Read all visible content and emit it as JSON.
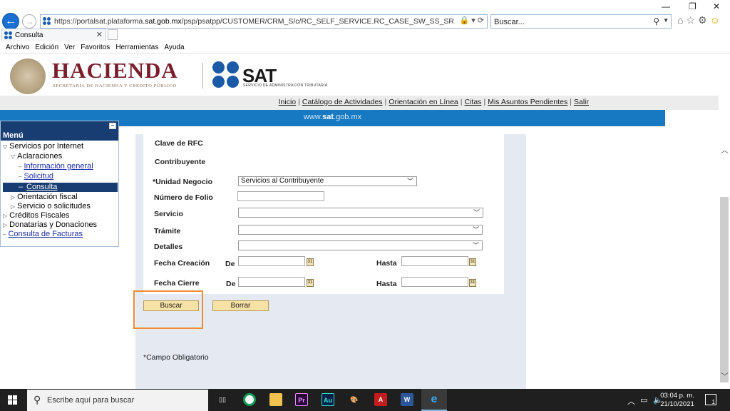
{
  "browser": {
    "url_prefix": "https://portalsat.plataforma.",
    "url_domain": "sat.gob.mx",
    "url_rest": "/psp/psatpp/CUSTOMER/CRM_S/c/RC_SELF_SERVICE.RC_CASE_SW_SS_SRCH.GBL?DISP_TMPL_ID=RC_SU",
    "search_placeholder": "Buscar...",
    "tab_title": "Consulta",
    "menu": [
      "Archivo",
      "Edición",
      "Ver",
      "Favoritos",
      "Herramientas",
      "Ayuda"
    ]
  },
  "header": {
    "hacienda_title": "HACIENDA",
    "hacienda_subtitle": "SECRETARÍA DE HACIENDA Y CRÉDITO PÚBLICO",
    "sat_title": "SAT",
    "sat_subtitle": "SERVICIO DE ADMINISTRACIÓN TRIBUTARIA"
  },
  "topnav": [
    "Inicio",
    "Catálogo de Actividades",
    "Orientación en Línea",
    "Citas",
    "Mis Asuntos Pendientes",
    "Salir"
  ],
  "bluebar": {
    "pre": "www.",
    "bold": "sat",
    "post": ".gob.mx"
  },
  "sidebar": {
    "title": "Menú",
    "items": [
      "Servicios por Internet",
      "Aclaraciones",
      "Información general",
      "Solicitud",
      "Consulta",
      "Orientación fiscal",
      "Servicio o solicitudes",
      "Créditos Fiscales",
      "Donatarias y Donaciones",
      "Consulta de Facturas"
    ]
  },
  "form": {
    "rfc_label": "Clave de RFC",
    "contribuyente_label": "Contribuyente",
    "unidad_label": "*Unidad Negocio",
    "unidad_value": "Servicios al Contribuyente",
    "folio_label": "Número de Folio",
    "servicio_label": "Servicio",
    "tramite_label": "Trámite",
    "detalles_label": "Detalles",
    "fecha_creacion_label": "Fecha Creación",
    "fecha_cierre_label": "Fecha Cierre",
    "de_label": "De",
    "hasta_label": "Hasta",
    "calendar_glyph": "31",
    "buscar_label": "Buscar",
    "borrar_label": "Borrar",
    "required_note": "*Campo Obligatorio"
  },
  "taskbar": {
    "search_placeholder": "Escribe aquí para buscar",
    "time": "03:04 p. m.",
    "date": "21/10/2021",
    "notifications": "1"
  }
}
